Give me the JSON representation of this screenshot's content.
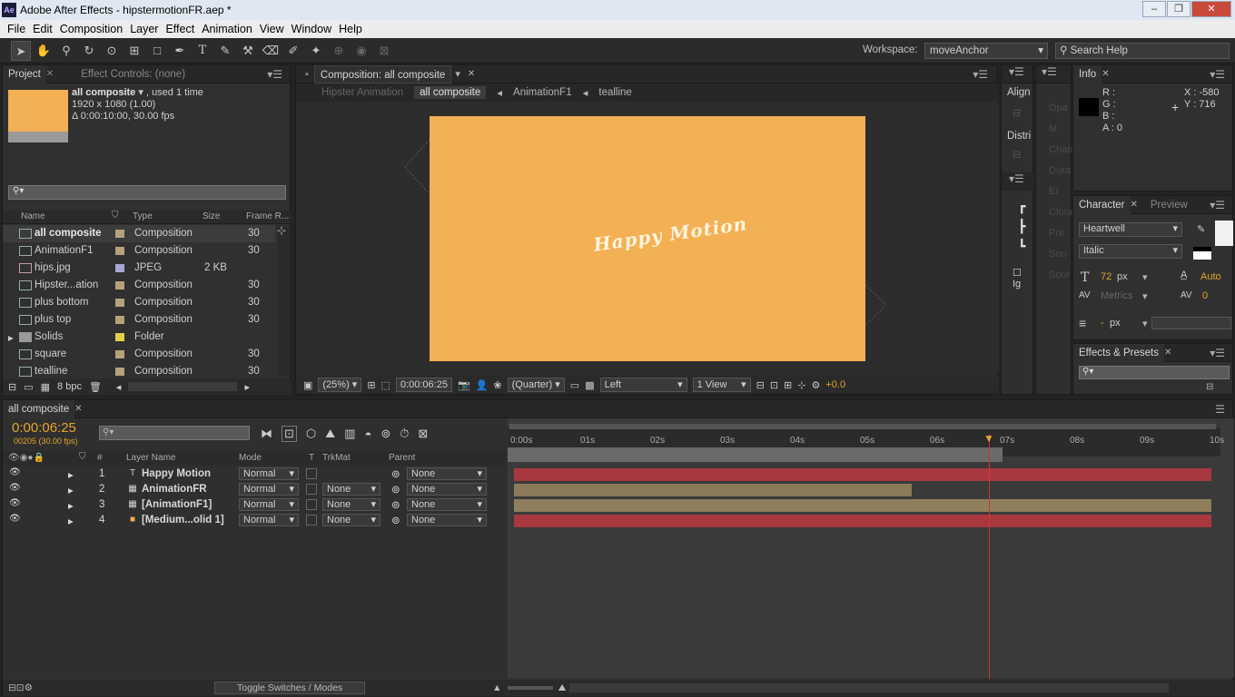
{
  "window": {
    "title": "Adobe After Effects - hipstermotionFR.aep *",
    "logo": "Ae",
    "buttons": [
      "–",
      "❐",
      "✕"
    ]
  },
  "menu": [
    "File",
    "Edit",
    "Composition",
    "Layer",
    "Effect",
    "Animation",
    "View",
    "Window",
    "Help"
  ],
  "toolbar": {
    "workspace_label": "Workspace:",
    "workspace_value": "moveAnchor",
    "search_help": "Search Help"
  },
  "project": {
    "tabs": [
      "Project",
      "Effect Controls: (none)"
    ],
    "selected_name": "all composite",
    "selected_used": ", used 1 time",
    "selected_dims": "1920 x 1080 (1.00)",
    "selected_duration": "Δ 0:00:10:00, 30.00 fps",
    "columns": [
      "Name",
      "Type",
      "Size",
      "Frame R..."
    ],
    "items": [
      {
        "name": "all composite",
        "type": "Composition",
        "size": "",
        "fr": "30",
        "color": "#b5a27a",
        "icon": "composition-icon"
      },
      {
        "name": "AnimationF1",
        "type": "Composition",
        "size": "",
        "fr": "30",
        "color": "#b5a27a",
        "icon": "composition-icon"
      },
      {
        "name": "hips.jpg",
        "type": "JPEG",
        "size": "2 KB",
        "fr": "",
        "color": "#a9a6d8",
        "icon": "image-icon"
      },
      {
        "name": "Hipster...ation",
        "type": "Composition",
        "size": "",
        "fr": "30",
        "color": "#b5a27a",
        "icon": "composition-icon"
      },
      {
        "name": "plus bottom",
        "type": "Composition",
        "size": "",
        "fr": "30",
        "color": "#b5a27a",
        "icon": "composition-icon"
      },
      {
        "name": "plus top",
        "type": "Composition",
        "size": "",
        "fr": "30",
        "color": "#b5a27a",
        "icon": "composition-icon"
      },
      {
        "name": "Solids",
        "type": "Folder",
        "size": "",
        "fr": "",
        "color": "#e0d04a",
        "icon": "folder-icon"
      },
      {
        "name": "square",
        "type": "Composition",
        "size": "",
        "fr": "30",
        "color": "#b5a27a",
        "icon": "composition-icon"
      },
      {
        "name": "tealline",
        "type": "Composition",
        "size": "",
        "fr": "30",
        "color": "#b5a27a",
        "icon": "composition-icon"
      }
    ],
    "bpc": "8 bpc"
  },
  "viewer": {
    "tab": "Composition: all composite",
    "breadcrumbs": [
      "Hipster Animation",
      "all composite",
      "AnimationF1",
      "tealline"
    ],
    "text": "Happy Motion",
    "zoom": "(25%)",
    "timecode": "0:00:06:25",
    "resolution": "(Quarter)",
    "view": "Left",
    "views": "1 View",
    "exposure": "+0.0"
  },
  "side": {
    "align_title": "Align",
    "distribute_title": "Distri",
    "ghost_labels": [
      "Opa",
      "M",
      "Chan",
      "Dura",
      "Er",
      "Clone",
      "Pre",
      "Sou",
      "Sour"
    ],
    "ig_label": "Ig"
  },
  "info": {
    "tab": "Info",
    "r": "R :",
    "g": "G :",
    "b": "B :",
    "a": "A : 0",
    "x": "X : -580",
    "y": "Y : 716"
  },
  "character": {
    "tabs": [
      "Character",
      "Preview"
    ],
    "font": "Heartwell",
    "style": "Italic",
    "size": "72",
    "size_unit": "px",
    "leading": "Auto",
    "kerning": "Metrics",
    "tracking": "0",
    "stroke": "-",
    "stroke_unit": "px"
  },
  "effects": {
    "tab": "Effects & Presets"
  },
  "timeline": {
    "tab": "all composite",
    "timecode": "0:00:06:25",
    "frames": "00205 (30.00 fps)",
    "columns": {
      "layer": "Layer Name",
      "mode": "Mode",
      "t": "T",
      "trkmat": "TrkMat",
      "parent": "Parent"
    },
    "layers": [
      {
        "num": "1",
        "name": "Happy Motion",
        "mode": "Normal",
        "trk": "",
        "parent": "None",
        "label": "#c94646",
        "icon": "T",
        "bar_color": "#a8383f",
        "bar_end": 1.0
      },
      {
        "num": "2",
        "name": "AnimationFR",
        "mode": "Normal",
        "trk": "None",
        "parent": "None",
        "label": "#b5a27a",
        "icon": "▦",
        "bar_color": "#8a7a5a",
        "bar_end": 0.57
      },
      {
        "num": "3",
        "name": "[AnimationF1]",
        "mode": "Normal",
        "trk": "None",
        "parent": "None",
        "label": "#b5a27a",
        "icon": "▦",
        "bar_color": "#8f7e5c",
        "bar_end": 1.0
      },
      {
        "num": "4",
        "name": "[Medium...olid 1]",
        "mode": "Normal",
        "trk": "None",
        "parent": "None",
        "label": "#c94646",
        "icon": "■",
        "bar_color": "#a8383f",
        "bar_end": 1.0
      }
    ],
    "ticks": [
      "0:00s",
      "01s",
      "02s",
      "03s",
      "04s",
      "05s",
      "06s",
      "07s",
      "08s",
      "09s",
      "10s"
    ],
    "toggle_label": "Toggle Switches / Modes"
  }
}
